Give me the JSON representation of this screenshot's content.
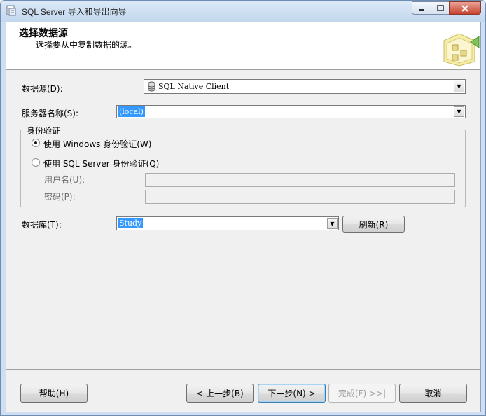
{
  "window": {
    "title": "SQL Server 导入和导出向导",
    "min_icon": "minimize-icon",
    "max_icon": "maximize-icon",
    "close_icon": "close-icon"
  },
  "header": {
    "title": "选择数据源",
    "subtitle": "选择要从中复制数据的源。",
    "graphic_icon": "wizard-graphic-icon"
  },
  "form": {
    "datasource_label": "数据源(D):",
    "datasource_value": "SQL Native Client",
    "server_label": "服务器名称(S):",
    "server_value": "(local)",
    "auth_group_label": "身份验证",
    "auth_windows_label": "使用 Windows 身份验证(W)",
    "auth_sql_label": "使用 SQL Server 身份验证(Q)",
    "auth_selected": "windows",
    "username_label": "用户名(U):",
    "username_value": "",
    "password_label": "密码(P):",
    "password_value": "",
    "database_label": "数据库(T):",
    "database_value": "Study",
    "refresh_label": "刷新(R)"
  },
  "footer": {
    "help_label": "帮助(H)",
    "back_label": "< 上一步(B)",
    "next_label": "下一步(N) >",
    "finish_label": "完成(F) >>|",
    "cancel_label": "取消"
  },
  "colors": {
    "selection": "#3399ff",
    "titlebar": "#c3d7ee",
    "close_button": "#c7422d"
  }
}
